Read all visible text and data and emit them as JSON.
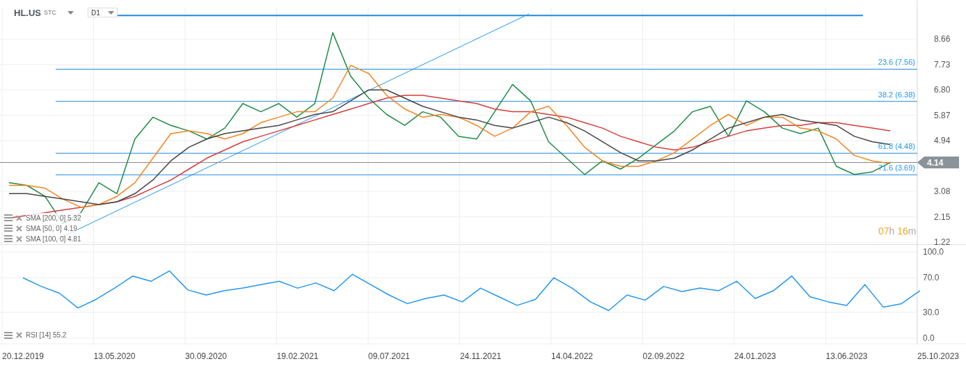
{
  "header": {
    "symbol": "HL.US",
    "exchange": "STC",
    "interval": "D1"
  },
  "legends": [
    {
      "label": "SMA [200, 0] 5.32"
    },
    {
      "label": "SMA [50, 0] 4.19"
    },
    {
      "label": "SMA [100, 0] 4.81"
    }
  ],
  "countdown": {
    "hours": "07",
    "hours_unit": "h",
    "minutes": "16",
    "minutes_unit": "m"
  },
  "price_chart": {
    "chart_data": {
      "type": "line",
      "grid": true,
      "categories": [
        null,
        null,
        null,
        null,
        null,
        null,
        null,
        null,
        null,
        null,
        null,
        null,
        null,
        null,
        null,
        null,
        null,
        null,
        null,
        null,
        null,
        null,
        null,
        null,
        null,
        null,
        null,
        null,
        null,
        null,
        null,
        null,
        null,
        null,
        null,
        null,
        null,
        null,
        null,
        null,
        null,
        null,
        null,
        null,
        null,
        null,
        null,
        null,
        null,
        null,
        null
      ],
      "series": [
        {
          "color": "#1e8c45",
          "values": [
            3.4,
            3.3,
            2.9,
            1.9,
            2.3,
            3.4,
            3.0,
            5.0,
            5.8,
            5.5,
            5.3,
            5.0,
            5.4,
            6.3,
            6.0,
            6.3,
            5.8,
            6.3,
            8.9,
            7.3,
            6.5,
            5.9,
            5.5,
            6.0,
            5.8,
            5.1,
            5.0,
            6.0,
            7.0,
            6.4,
            4.9,
            4.3,
            3.7,
            4.2,
            3.9,
            4.3,
            4.8,
            5.3,
            6.0,
            6.2,
            5.1,
            6.4,
            6.0,
            5.4,
            5.2,
            5.4,
            4.0,
            3.7,
            3.8,
            4.14,
            null
          ]
        },
        {
          "color": "#d93a3a",
          "values": [
            2.1,
            2.2,
            2.3,
            2.4,
            2.5,
            2.6,
            2.7,
            2.9,
            3.2,
            3.5,
            3.9,
            4.3,
            4.6,
            4.9,
            5.1,
            5.3,
            5.5,
            5.7,
            5.9,
            6.1,
            6.3,
            6.5,
            6.6,
            6.6,
            6.5,
            6.4,
            6.3,
            6.1,
            6.0,
            6.0,
            5.9,
            5.8,
            5.6,
            5.4,
            5.1,
            4.9,
            4.7,
            4.6,
            4.7,
            4.9,
            5.1,
            5.3,
            5.4,
            5.5,
            5.5,
            5.6,
            5.6,
            5.5,
            5.4,
            5.3,
            null
          ]
        },
        {
          "color": "#f5841f",
          "values": [
            3.3,
            3.3,
            3.2,
            2.8,
            2.5,
            2.6,
            2.9,
            3.4,
            4.3,
            5.2,
            5.3,
            5.2,
            5.0,
            5.2,
            5.6,
            5.8,
            6.0,
            6.0,
            6.5,
            7.7,
            7.4,
            6.6,
            6.1,
            5.8,
            5.9,
            5.8,
            5.5,
            5.1,
            5.4,
            6.0,
            6.2,
            5.5,
            4.7,
            4.2,
            4.0,
            4.0,
            4.2,
            4.5,
            5.0,
            5.5,
            5.9,
            5.5,
            5.8,
            5.8,
            5.4,
            5.3,
            5.0,
            4.4,
            4.2,
            4.1,
            null
          ]
        },
        {
          "color": "#444444",
          "values": [
            3.0,
            3.0,
            2.9,
            2.8,
            2.7,
            2.6,
            2.7,
            3.0,
            3.5,
            4.2,
            4.7,
            5.0,
            5.2,
            5.3,
            5.4,
            5.5,
            5.7,
            5.9,
            6.0,
            6.4,
            6.8,
            6.8,
            6.5,
            6.2,
            6.0,
            5.8,
            5.7,
            5.5,
            5.4,
            5.6,
            5.8,
            5.6,
            5.3,
            4.9,
            4.5,
            4.2,
            4.2,
            4.3,
            4.6,
            5.0,
            5.4,
            5.6,
            5.8,
            5.9,
            5.7,
            5.6,
            5.5,
            5.1,
            4.9,
            4.8,
            null
          ]
        }
      ],
      "ylim": [
        1.12,
        9.84
      ],
      "yticks": [
        {
          "value": 1.22,
          "label": "1.22"
        },
        {
          "value": 2.15,
          "label": "2.15"
        },
        {
          "value": 3.08,
          "label": "3.08"
        },
        {
          "value": 4.94,
          "label": "4.94"
        },
        {
          "value": 5.87,
          "label": "5.87"
        },
        {
          "value": 6.8,
          "label": "6.80"
        },
        {
          "value": 7.73,
          "label": "7.73"
        },
        {
          "value": 8.66,
          "label": "8.66"
        }
      ],
      "ref_lines": [
        {
          "axis": "y",
          "value": 9.53,
          "color": "#1e88e5"
        },
        {
          "axis": "y",
          "value": 7.56,
          "label": "23.6 (7.56)",
          "color": "#1e88e5"
        },
        {
          "axis": "y",
          "value": 6.38,
          "label": "38.2 (6.38)",
          "color": "#1e88e5"
        },
        {
          "axis": "y",
          "value": 4.48,
          "label": "61.8 (4.48)",
          "color": "#1e88e5"
        },
        {
          "axis": "y",
          "value": 3.69,
          "label": "71.6 (3.69)",
          "color": "#1e88e5"
        },
        {
          "axis": "y",
          "value": 4.14,
          "label": "4.14",
          "color": "#888888"
        }
      ]
    }
  },
  "rsi_chart": {
    "legend": "RSI [14] 55.2",
    "chart_data": {
      "type": "line",
      "grid": true,
      "categories": [
        "20.12.2019",
        null,
        null,
        null,
        null,
        "13.05.2020",
        null,
        null,
        null,
        null,
        "30.09.2020",
        null,
        null,
        null,
        null,
        "19.02.2021",
        null,
        null,
        null,
        null,
        "09.07.2021",
        null,
        null,
        null,
        null,
        "24.11.2021",
        null,
        null,
        null,
        null,
        "14.04.2022",
        null,
        null,
        null,
        null,
        "02.09.2022",
        null,
        null,
        null,
        null,
        "24.01.2023",
        null,
        null,
        null,
        null,
        "13.06.2023",
        null,
        null,
        null,
        null,
        "25.10.2023"
      ],
      "series": [
        {
          "color": "#2196f3",
          "values": [
            70,
            60,
            52,
            35,
            45,
            58,
            72,
            66,
            78,
            56,
            50,
            55,
            58,
            62,
            66,
            58,
            64,
            55,
            74,
            62,
            50,
            40,
            46,
            50,
            42,
            58,
            48,
            38,
            45,
            70,
            58,
            42,
            32,
            50,
            44,
            60,
            54,
            58,
            55,
            66,
            46,
            55,
            72,
            48,
            42,
            38,
            62,
            36,
            40,
            55,
            null
          ]
        }
      ],
      "ylim": [
        0,
        100
      ],
      "yticks": [
        {
          "value": 0,
          "label": "0.0"
        },
        {
          "value": 30,
          "label": "30.0"
        },
        {
          "value": 70,
          "label": "70.0"
        },
        {
          "value": 100,
          "label": "100.0"
        }
      ]
    }
  }
}
